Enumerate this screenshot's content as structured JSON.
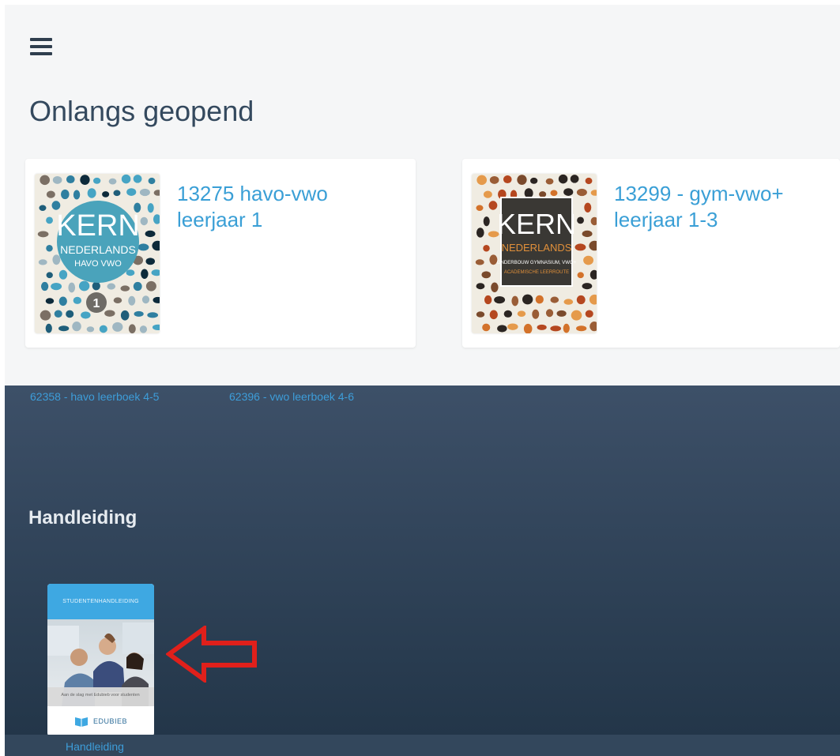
{
  "header": {
    "menu_icon": "hamburger-menu-icon"
  },
  "recent": {
    "heading": "Onlangs geopend",
    "books": [
      {
        "title": "13275 havo-vwo leerjaar 1",
        "cover": {
          "brand": "KERN",
          "subtitle": "NEDERLANDS",
          "level": "HAVO VWO",
          "badge": "1"
        }
      },
      {
        "title": "13299 - gym-vwo+ leerjaar 1-3",
        "cover": {
          "brand": "KERN",
          "subtitle": "NEDERLANDS",
          "line1": "ONDERBOUW GYMNASIUM, VWO+",
          "line2": "ACADEMISCHE LEERROUTE"
        }
      }
    ]
  },
  "links": [
    "62358 - havo leerboek 4-5",
    "62396 - vwo leerboek 4-6"
  ],
  "manual_section": {
    "heading": "Handleiding",
    "item": {
      "cover_header": "STUDENTENHANDLEIDING",
      "cover_caption": "Aan de slag met Edubieb voor studenten",
      "logo_text": "EDUBIEB",
      "label": "Handleiding"
    }
  },
  "annotation": {
    "arrow_icon": "left-arrow-icon",
    "color": "#e0201b"
  },
  "colors": {
    "link": "#3a9fd6",
    "panel_dark": "#233649",
    "panel_light": "#3d5068"
  }
}
